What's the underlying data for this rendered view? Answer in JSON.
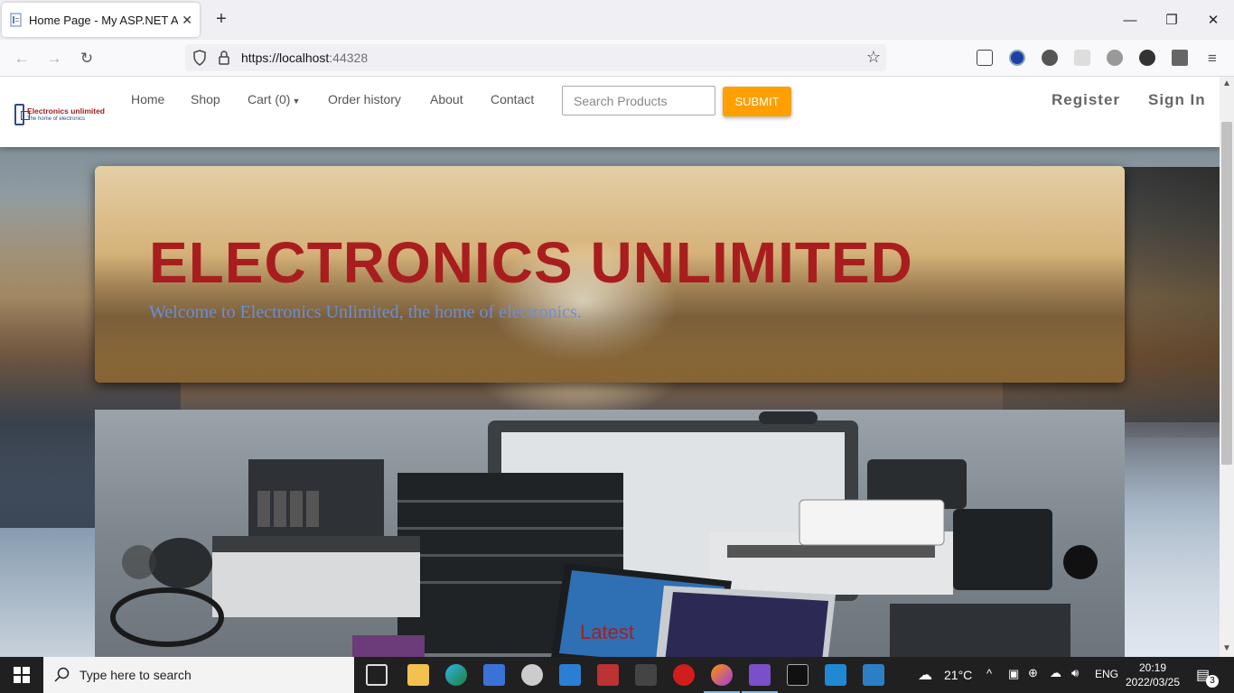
{
  "browser": {
    "tab_title": "Home Page - My ASP.NET Appl",
    "url_host": "https://localhost",
    "url_port": ":44328"
  },
  "site": {
    "logo_name": "Electronics unlimited",
    "logo_tagline": "The home of electronics",
    "nav": {
      "home": "Home",
      "shop": "Shop",
      "cart": "Cart (0)",
      "order_history": "Order history",
      "about": "About",
      "contact": "Contact"
    },
    "search": {
      "placeholder": "Search Products",
      "submit_label": "SUBMIT"
    },
    "auth": {
      "register": "Register",
      "sign_in": "Sign In"
    },
    "hero": {
      "title": "ELECTRONICS UNLIMITED",
      "subtitle": "Welcome to Electronics Unlimited, the home of electronics."
    },
    "carousel": {
      "caption": "Latest"
    }
  },
  "taskbar": {
    "search_placeholder": "Type here to search",
    "weather": "21°C",
    "language": "ENG",
    "time": "20:19",
    "date": "2022/03/25",
    "notifications": "3"
  },
  "colors": {
    "brand_red": "#a81e1e",
    "submit_orange": "#ff9f00",
    "subtitle_blue": "#6a8fd8"
  }
}
